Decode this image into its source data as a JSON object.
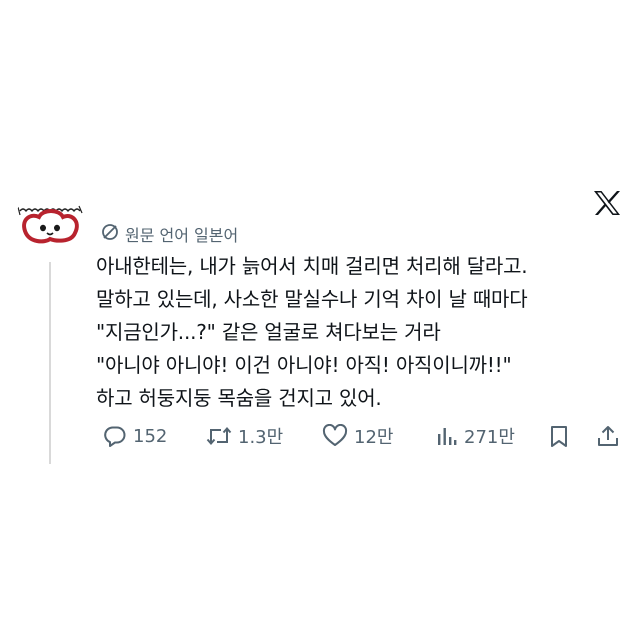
{
  "tweet": {
    "translation_label": "원문 언어 일본어",
    "lines": [
      "아내한테는, 내가 늙어서 치매 걸리면 처리해 달라고.",
      "말하고 있는데, 사소한 말실수나 기억 차이 날 때마다",
      "\"지금인가...?\" 같은 얼굴로 쳐다보는 거라",
      "\"아니야 아니야! 이건 아니야! 아직! 아직이니까!!\"",
      "하고 허둥지둥 목숨을 건지고 있어."
    ]
  },
  "actions": {
    "reply_count": "152",
    "retweet_count": "1.3만",
    "like_count": "12만",
    "view_count": "271만"
  },
  "icons": {
    "logo": "x-logo-icon",
    "translate": "translate-globe-icon",
    "reply": "reply-icon",
    "retweet": "retweet-icon",
    "like": "heart-icon",
    "views": "views-bar-icon",
    "bookmark": "bookmark-icon",
    "share": "share-icon"
  },
  "colors": {
    "text": "#0f1419",
    "secondary": "#536471",
    "avatar_accent": "#b8232e"
  }
}
